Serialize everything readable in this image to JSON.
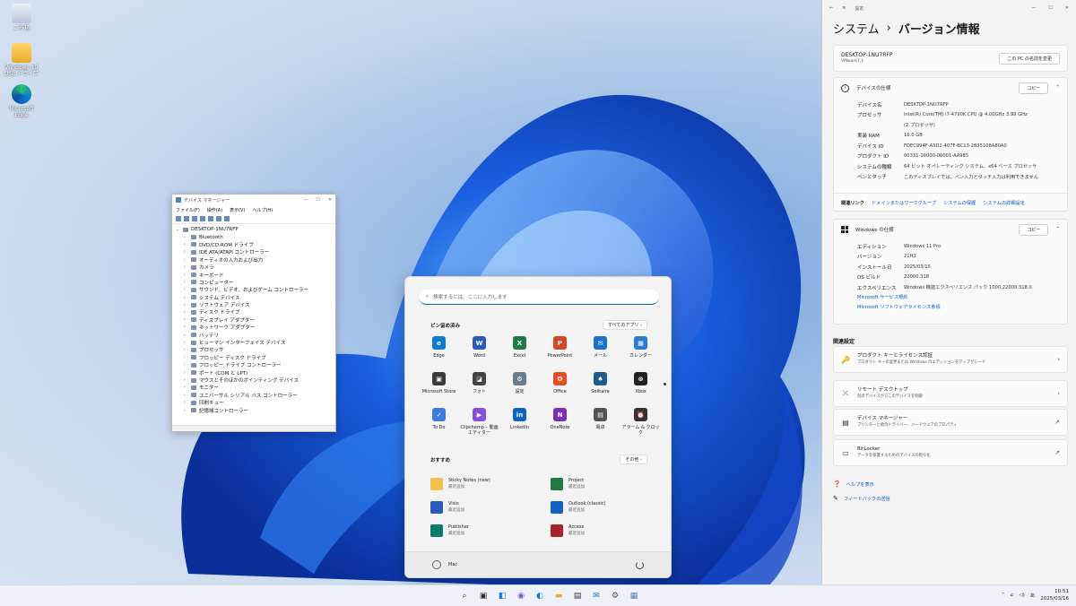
{
  "desktop": {
    "icons": [
      {
        "label": "ごみ箱"
      },
      {
        "label": "Windows 10 USB ドライブ"
      },
      {
        "label": "Microsoft Edge"
      }
    ]
  },
  "devmgr": {
    "title": "デバイス マネージャー",
    "menu": [
      "ファイル(F)",
      "操作(A)",
      "表示(V)",
      "ヘルプ(H)"
    ],
    "root": "DESKTOP-1NU7RFP",
    "nodes": [
      "Bluetooth",
      "DVD/CD-ROM ドライブ",
      "IDE ATA/ATAPI コントローラー",
      "オーディオの入力および出力",
      "カメラ",
      "キーボード",
      "コンピューター",
      "サウンド、ビデオ、およびゲーム コントローラー",
      "システム デバイス",
      "ソフトウェア デバイス",
      "ディスク ドライブ",
      "ディスプレイ アダプター",
      "ネットワーク アダプター",
      "バッテリ",
      "ヒューマン インターフェイス デバイス",
      "プロセッサ",
      "フロッピー ディスク ドライブ",
      "フロッピー ドライブ コントローラー",
      "ポート (COM と LPT)",
      "マウスとそのほかのポインティング デバイス",
      "モニター",
      "ユニバーサル シリアル バス コントローラー",
      "印刷キュー",
      "記憶域コントローラー"
    ]
  },
  "start": {
    "search_placeholder": "検索するには、ここに入力します",
    "pinned_title": "ピン留め済み",
    "all_apps": "すべてのアプリ ›",
    "pinned": [
      {
        "label": "Edge",
        "color": "#0c7bd0",
        "glyph": "e"
      },
      {
        "label": "Word",
        "color": "#2b5bb8",
        "glyph": "W"
      },
      {
        "label": "Excel",
        "color": "#1f7a45",
        "glyph": "X"
      },
      {
        "label": "PowerPoint",
        "color": "#d24726",
        "glyph": "P"
      },
      {
        "label": "メール",
        "color": "#1a73c9",
        "glyph": "✉"
      },
      {
        "label": "カレンダー",
        "color": "#2b7bd0",
        "glyph": "▦"
      },
      {
        "label": "Microsoft Store",
        "color": "#3a3a3a",
        "glyph": "▣"
      },
      {
        "label": "フォト",
        "color": "#444",
        "glyph": "◪"
      },
      {
        "label": "設定",
        "color": "#6b7a8c",
        "glyph": "⚙"
      },
      {
        "label": "Office",
        "color": "#e84b24",
        "glyph": "O"
      },
      {
        "label": "Solitaire",
        "color": "#1e5a8a",
        "glyph": "♠"
      },
      {
        "label": "Xbox",
        "color": "#222",
        "glyph": "⊗"
      },
      {
        "label": "To Do",
        "color": "#3b7ddd",
        "glyph": "✓"
      },
      {
        "label": "Clipchamp – 動画エディター",
        "color": "#8a4fd8",
        "glyph": "▶"
      },
      {
        "label": "LinkedIn",
        "color": "#0a66c2",
        "glyph": "in"
      },
      {
        "label": "OneNote",
        "color": "#7b2fb5",
        "glyph": "N"
      },
      {
        "label": "電卓",
        "color": "#555",
        "glyph": "▤"
      },
      {
        "label": "アラーム & クロック",
        "color": "#333",
        "glyph": "⏰"
      }
    ],
    "recommended_title": "おすすめ",
    "more": "その他 ›",
    "recommended": [
      {
        "label": "Sticky Notes (new)",
        "sub": "最近追加",
        "color": "#f2c14e"
      },
      {
        "label": "Project",
        "sub": "最近追加",
        "color": "#1f7a45"
      },
      {
        "label": "Visio",
        "sub": "最近追加",
        "color": "#2b5bb8"
      },
      {
        "label": "Outlook (classic)",
        "sub": "最近追加",
        "color": "#1463c4"
      },
      {
        "label": "Publisher",
        "sub": "最近追加",
        "color": "#0e7a6b"
      },
      {
        "label": "Access",
        "sub": "最近追加",
        "color": "#a4262c"
      }
    ],
    "user": "Mac"
  },
  "settings": {
    "window_title": "設定",
    "crumb_parent": "システム",
    "crumb_sep": "›",
    "crumb_current": "バージョン情報",
    "pc_name": "DESKTOP-1NU7RFP",
    "pc_model": "VMware7,1",
    "rename_btn": "この PC の名前を変更",
    "device_spec_title": "デバイスの仕様",
    "copy_btn": "コピー",
    "device_specs": [
      {
        "k": "デバイス名",
        "v": "DESKTOP-1NU7RFP"
      },
      {
        "k": "プロセッサ",
        "v": "Intel(R) Core(TM) i7-4790K CPU @ 4.00GHz   3.99 GHz"
      },
      {
        "k": "",
        "v": "(2 プロセッサ)"
      },
      {
        "k": "実装 RAM",
        "v": "16.0 GB"
      },
      {
        "k": "デバイス ID",
        "v": "FDEC994F-A5D2-407F-BC13-2835108A80A0"
      },
      {
        "k": "プロダクト ID",
        "v": "00331-10000-00001-AA985"
      },
      {
        "k": "システムの種類",
        "v": "64 ビット オペレーティング システム、x64 ベース プロセッサ"
      },
      {
        "k": "ペンとタッチ",
        "v": "このディスプレイでは、ペン入力とタッチ入力は利用できません"
      }
    ],
    "related_links_label": "関連リンク",
    "related_links": [
      "ドメインまたはワークグループ",
      "システムの保護",
      "システムの詳細設定"
    ],
    "windows_spec_title": "Windows の仕様",
    "windows_specs": [
      {
        "k": "エディション",
        "v": "Windows 11 Pro"
      },
      {
        "k": "バージョン",
        "v": "21H2"
      },
      {
        "k": "インストール日",
        "v": "2025/03/15"
      },
      {
        "k": "OS ビルド",
        "v": "22000.318"
      },
      {
        "k": "エクスペリエンス",
        "v": "Windows 機能エクスペリエンス パック 1000.22000.318.0"
      }
    ],
    "ms_service": "Microsoft サービス規約",
    "ms_license": "Microsoft ソフトウェアライセンス条項",
    "related_settings": "関連設定",
    "rel_items": [
      {
        "main": "プロダクト キーとライセンス認証",
        "sub": "プロダクト キーの変更または Windows のエディションをアップグレード",
        "icon": "🔑",
        "arrow": "›"
      },
      {
        "main": "リモート デスクトップ",
        "sub": "別のデバイスからこのデバイスを制御",
        "icon": "⤫",
        "arrow": "›"
      },
      {
        "main": "デバイス マネージャー",
        "sub": "プリンターと他のドライバー、ハードウェアのプロパティ",
        "icon": "▤",
        "arrow": "↗"
      },
      {
        "main": "BitLocker",
        "sub": "データを保護するためのデバイスの暗号化",
        "icon": "▭",
        "arrow": "↗"
      }
    ],
    "help": "ヘルプを表示",
    "feedback": "フィードバックの送信"
  },
  "taskbar": {
    "time": "10:51",
    "date": "2025/03/16"
  }
}
